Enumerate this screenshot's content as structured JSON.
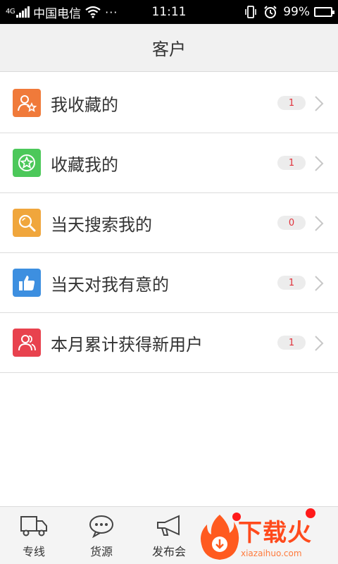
{
  "status_bar": {
    "signal_label": "4G",
    "carrier": "中国电信",
    "more": "···",
    "time": "11:11",
    "battery": "99%",
    "battery_level": 0.99
  },
  "header": {
    "title": "客户"
  },
  "list": [
    {
      "label": "我收藏的",
      "count": "1",
      "icon": "user-star-icon",
      "color": "#f07a3a"
    },
    {
      "label": "收藏我的",
      "count": "1",
      "icon": "star-circle-icon",
      "color": "#4cc85a"
    },
    {
      "label": "当天搜索我的",
      "count": "0",
      "icon": "search-icon",
      "color": "#f0a63c"
    },
    {
      "label": "当天对我有意的",
      "count": "1",
      "icon": "thumbs-up-icon",
      "color": "#3d8fe0"
    },
    {
      "label": "本月累计获得新用户",
      "count": "1",
      "icon": "users-icon",
      "color": "#e8424e"
    }
  ],
  "tabs": [
    {
      "label": "专线",
      "icon": "truck-icon"
    },
    {
      "label": "货源",
      "icon": "chat-bubble-icon"
    },
    {
      "label": "发布会",
      "icon": "megaphone-icon"
    }
  ],
  "watermark": {
    "text": "下载火",
    "url": "xiazaihuo.com"
  }
}
